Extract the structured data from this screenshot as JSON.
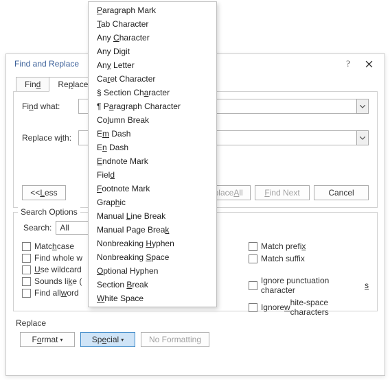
{
  "dialog": {
    "title": "Find and Replace",
    "help": "?",
    "tabs": {
      "find": "Fin",
      "find_ul": "d",
      "replace_pre": "Re",
      "replace_ul": "p",
      "replace_post": "lace"
    },
    "findwhat_pre": "Fi",
    "findwhat_ul": "n",
    "findwhat_post": "d what:",
    "replacewith_pre": "Replace w",
    "replacewith_ul": "i",
    "replacewith_post": "th:",
    "findwhat_value": "",
    "replacewith_value": "",
    "less_pre": "<< ",
    "less_ul": "L",
    "less_post": "ess",
    "replaceall_pre": "Replace ",
    "replaceall_ul": "A",
    "replaceall_post": "ll",
    "findnext_ul": "F",
    "findnext_post": "ind Next",
    "cancel": "Cancel"
  },
  "options": {
    "title": "Search Options",
    "search_lbl": "Search",
    "search_colon_ul": ":",
    "search_value": "All",
    "left": [
      {
        "pre": "Matc",
        "ul": "h",
        "post": " case"
      },
      {
        "pre": "Find whole w",
        "ul": "",
        "post": ""
      },
      {
        "pre": "",
        "ul": "U",
        "post": "se wildcard"
      },
      {
        "pre": "Sounds li",
        "ul": "k",
        "post": "e ("
      },
      {
        "pre": "Find all ",
        "ul": "w",
        "post": "ord"
      }
    ],
    "right": [
      {
        "pre": "Match prefi",
        "ul": "x",
        "post": ""
      },
      {
        "pre": "Match suffi",
        "ul": "",
        "post": "x"
      },
      {
        "pre": "Ignore punctuation character",
        "ul": "s",
        "post": ""
      },
      {
        "pre": "Ignore ",
        "ul": "w",
        "post": "hite-space characters"
      }
    ]
  },
  "bottom": {
    "replace_hdr": "Replace",
    "format_pre": "F",
    "format_ul": "o",
    "format_post": "rmat",
    "special_pre": "Sp",
    "special_ul": "e",
    "special_post": "cial",
    "nofmt_pre": "No Formatti",
    "nofmt_post": "ng"
  },
  "menu": [
    {
      "ul": "P",
      "rest": "aragraph Mark"
    },
    {
      "ul": "T",
      "rest": "ab Character"
    },
    {
      "pre": "Any ",
      "ul": "C",
      "rest": "haracter"
    },
    {
      "pre": "Any Di",
      "ul": "g",
      "rest": "it"
    },
    {
      "pre": "An",
      "ul": "y",
      "rest": " Letter"
    },
    {
      "pre": "Ca",
      "ul": "r",
      "rest": "et Character"
    },
    {
      "pre": "§ Section Ch",
      "ul": "a",
      "rest": "racter"
    },
    {
      "pre": "¶ P",
      "ul": "a",
      "rest": "ragraph Character"
    },
    {
      "pre": "Co",
      "ul": "l",
      "rest": "umn Break"
    },
    {
      "pre": "E",
      "ul": "m",
      "rest": " Dash"
    },
    {
      "pre": "E",
      "ul": "n",
      "rest": " Dash"
    },
    {
      "pre": "",
      "ul": "E",
      "rest": "ndnote Mark"
    },
    {
      "pre": "Fiel",
      "ul": "d",
      "rest": ""
    },
    {
      "pre": "",
      "ul": "F",
      "rest": "ootnote Mark"
    },
    {
      "pre": "Grap",
      "ul": "h",
      "rest": "ic"
    },
    {
      "pre": "Manual ",
      "ul": "L",
      "rest": "ine Break"
    },
    {
      "pre": "Manual Page Brea",
      "ul": "k",
      "rest": ""
    },
    {
      "pre": "Nonbreaking ",
      "ul": "H",
      "rest": "yphen"
    },
    {
      "pre": "Nonbreaking ",
      "ul": "S",
      "rest": "pace"
    },
    {
      "pre": "",
      "ul": "O",
      "rest": "ptional Hyphen"
    },
    {
      "pre": "Section ",
      "ul": "B",
      "rest": "reak"
    },
    {
      "pre": "",
      "ul": "W",
      "rest": "hite Space"
    }
  ]
}
